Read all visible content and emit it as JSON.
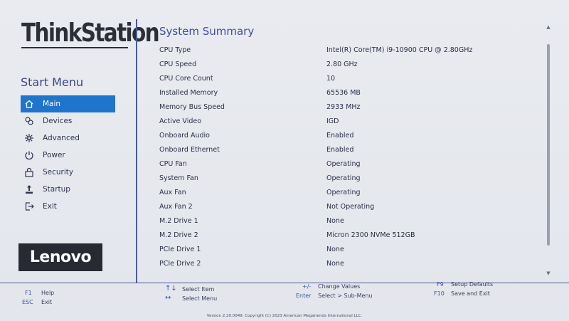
{
  "brand": "ThinkStation",
  "sidebar": {
    "heading": "Start Menu",
    "items": [
      {
        "label": "Main",
        "icon": "home-icon",
        "active": true
      },
      {
        "label": "Devices",
        "icon": "devices-icon",
        "active": false
      },
      {
        "label": "Advanced",
        "icon": "advanced-icon",
        "active": false
      },
      {
        "label": "Power",
        "icon": "power-icon",
        "active": false
      },
      {
        "label": "Security",
        "icon": "lock-icon",
        "active": false
      },
      {
        "label": "Startup",
        "icon": "startup-icon",
        "active": false
      },
      {
        "label": "Exit",
        "icon": "exit-icon",
        "active": false
      }
    ]
  },
  "logo": "Lenovo",
  "main": {
    "title": "System Summary",
    "rows": [
      {
        "key": "CPU Type",
        "value": "Intel(R) Core(TM) i9-10900 CPU @ 2.80GHz"
      },
      {
        "key": "CPU Speed",
        "value": "2.80 GHz"
      },
      {
        "key": "CPU Core Count",
        "value": "10"
      },
      {
        "key": "Installed Memory",
        "value": "65536 MB"
      },
      {
        "key": "Memory Bus Speed",
        "value": "2933 MHz"
      },
      {
        "key": "Active Video",
        "value": "IGD"
      },
      {
        "key": "Onboard Audio",
        "value": "Enabled"
      },
      {
        "key": "Onboard Ethernet",
        "value": "Enabled"
      },
      {
        "key": "CPU Fan",
        "value": "Operating"
      },
      {
        "key": "System Fan",
        "value": "Operating"
      },
      {
        "key": "Aux Fan",
        "value": "Operating"
      },
      {
        "key": "Aux Fan 2",
        "value": "Not Operating"
      },
      {
        "key": "M.2 Drive 1",
        "value": "None"
      },
      {
        "key": "M.2 Drive 2",
        "value": "Micron 2300 NVMe 512GB"
      },
      {
        "key": "PCIe Drive 1",
        "value": "None"
      },
      {
        "key": "PCIe Drive 2",
        "value": "None"
      }
    ]
  },
  "footer": {
    "f1_key": "F1",
    "f1_desc": "Help",
    "esc_key": "ESC",
    "esc_desc": "Exit",
    "updown_sym": "↑↓",
    "updown_desc": "Select Item",
    "leftright_sym": "↔",
    "leftright_desc": "Select Menu",
    "plusminus_key": "+/-",
    "plusminus_desc": "Change Values",
    "enter_key": "Enter",
    "enter_desc": "Select > Sub-Menu",
    "f9_key": "F9",
    "f9_desc": "Setup Defaults",
    "f10_key": "F10",
    "f10_desc": "Save and Exit",
    "version": "Version 2.20.0049. Copyright (C) 2023 American Megatrends International LLC."
  },
  "colors": {
    "accent": "#1f74cc",
    "title": "#3f4f9a",
    "divider": "#4a5a9a"
  }
}
